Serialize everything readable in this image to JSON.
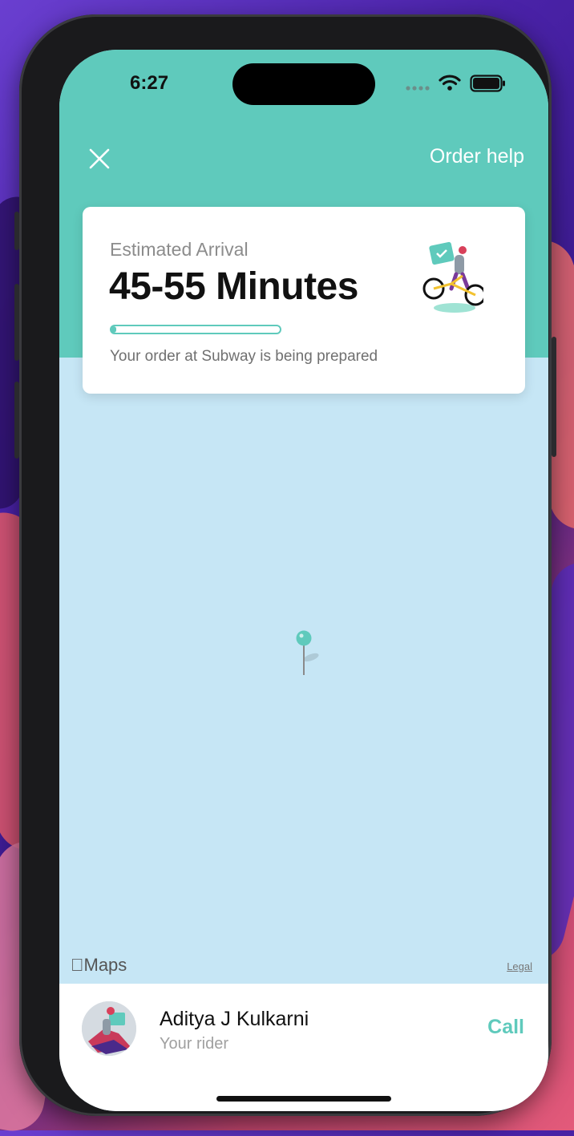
{
  "status_bar": {
    "time": "6:27"
  },
  "header": {
    "close_icon": "close-icon",
    "order_help_label": "Order help"
  },
  "eta_card": {
    "label": "Estimated Arrival",
    "value": "45-55 Minutes",
    "progress": 0.03,
    "status_text": "Your order at Subway is being prepared",
    "illustration": "rider-on-bicycle-illustration"
  },
  "map": {
    "attribution": "Maps",
    "legal_label": "Legal",
    "pin_icon": "map-pin-icon"
  },
  "rider": {
    "name": "Aditya J Kulkarni",
    "role": "Your rider",
    "call_label": "Call"
  },
  "colors": {
    "teal": "#5fcabc",
    "map_water": "#c6e6f5"
  }
}
